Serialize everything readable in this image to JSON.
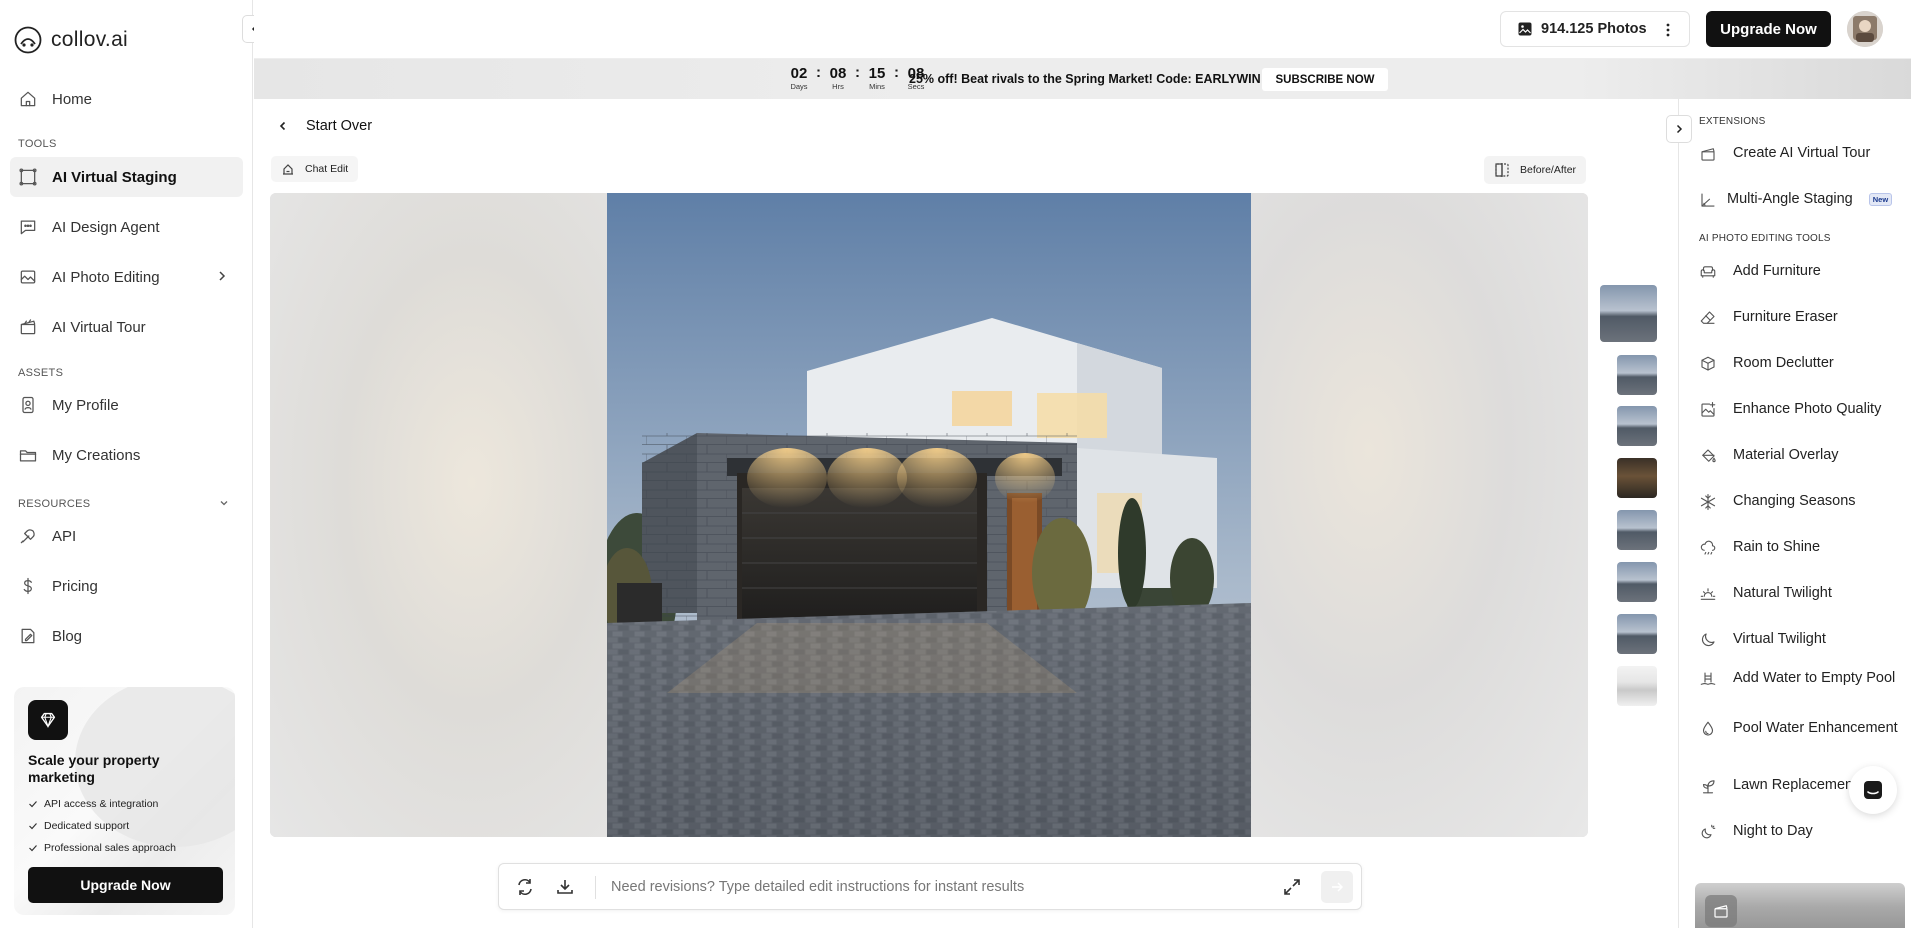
{
  "app": {
    "logo_text": "collov.ai"
  },
  "sidebar": {
    "home": "Home",
    "tools_label": "TOOLS",
    "tools": [
      {
        "label": "AI Virtual Staging",
        "icon": "staging-icon",
        "active": true
      },
      {
        "label": "AI Design Agent",
        "icon": "chat-bubble-icon"
      },
      {
        "label": "AI Photo Editing",
        "icon": "photo-edit-icon",
        "has_submenu": true
      },
      {
        "label": "AI Virtual Tour",
        "icon": "clapper-icon"
      }
    ],
    "assets_label": "ASSETS",
    "assets": [
      {
        "label": "My Profile",
        "icon": "profile-icon"
      },
      {
        "label": "My Creations",
        "icon": "folder-icon"
      }
    ],
    "resources_label": "RESOURCES",
    "resources": [
      {
        "label": "API",
        "icon": "api-icon"
      },
      {
        "label": "Pricing",
        "icon": "dollar-icon"
      },
      {
        "label": "Blog",
        "icon": "blog-icon"
      }
    ],
    "promo": {
      "title": "Scale your property marketing",
      "features": [
        "API access & integration",
        "Dedicated support",
        "Professional sales approach"
      ],
      "button": "Upgrade Now"
    }
  },
  "topbar": {
    "photos_count": "914.125 Photos",
    "upgrade": "Upgrade Now"
  },
  "banner": {
    "countdown": [
      {
        "value": "02",
        "unit": "Days"
      },
      {
        "value": "08",
        "unit": "Hrs"
      },
      {
        "value": "15",
        "unit": "Mins"
      },
      {
        "value": "08",
        "unit": "Secs"
      }
    ],
    "text": "25% off! Beat rivals to the Spring Market! Code: EARLYWIN",
    "button": "SUBSCRIBE NOW"
  },
  "main": {
    "start_over": "Start Over",
    "chat_edit": "Chat Edit",
    "before_after": "Before/After",
    "prompt_placeholder": "Need revisions? Type detailed edit instructions for instant results"
  },
  "right_panel": {
    "extensions_label": "EXTENSIONS",
    "extensions": [
      {
        "label": "Create AI Virtual Tour",
        "icon": "clapper-icon"
      },
      {
        "label": "Multi-Angle Staging",
        "icon": "angle-icon",
        "badge": "New"
      }
    ],
    "tools_label": "AI PHOTO EDITING TOOLS",
    "tools": [
      {
        "label": "Add Furniture",
        "icon": "sofa-icon"
      },
      {
        "label": "Furniture Eraser",
        "icon": "eraser-icon"
      },
      {
        "label": "Room Declutter",
        "icon": "declutter-icon"
      },
      {
        "label": "Enhance Photo Quality",
        "icon": "enhance-icon"
      },
      {
        "label": "Material Overlay",
        "icon": "paint-bucket-icon"
      },
      {
        "label": "Changing Seasons",
        "icon": "snowflake-icon"
      },
      {
        "label": "Rain to Shine",
        "icon": "cloud-rain-icon"
      },
      {
        "label": "Natural Twilight",
        "icon": "sunset-icon"
      },
      {
        "label": "Virtual Twilight",
        "icon": "moon-icon"
      },
      {
        "label": "Add Water to Empty Pool",
        "icon": "pool-ladder-icon"
      },
      {
        "label": "Pool Water Enhancement",
        "icon": "water-drop-icon"
      },
      {
        "label": "Lawn Replacement",
        "icon": "plant-icon"
      },
      {
        "label": "Night to Day",
        "icon": "sun-moon-icon"
      }
    ]
  }
}
